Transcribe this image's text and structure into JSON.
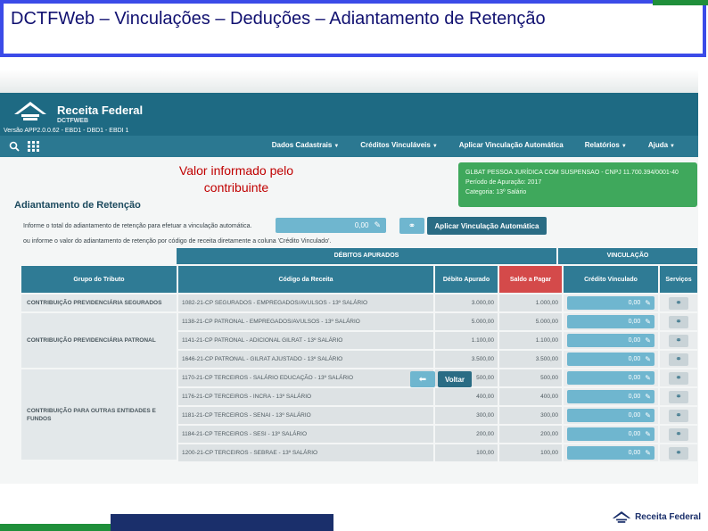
{
  "slide": {
    "title": "DCTFWeb – Vinculações – Deduções – Adiantamento de Retenção"
  },
  "app": {
    "brand": "Receita Federal",
    "product": "DCTFWEB",
    "version_line": "Versão APP2.0.0.62 - EBD1 - DBD1 - EBDI 1"
  },
  "nav": {
    "menu": [
      {
        "label": "Dados Cadastrais"
      },
      {
        "label": "Créditos Vinculáveis"
      },
      {
        "label": "Aplicar Vinculação Automática"
      },
      {
        "label": "Relatórios"
      },
      {
        "label": "Ajuda"
      }
    ]
  },
  "callout": "Valor informado pelo contribuinte",
  "info": {
    "line1": "GLBAT PESSOA JURÍDICA COM SUSPENSAO - CNPJ 11.700.394/0001-40",
    "line2": "Período de Apuração: 2017",
    "line3": "Categoria: 13º Salário"
  },
  "section_title": "Adiantamento de Retenção",
  "inform_text": "Informe o total do adiantamento de retenção para efetuar a vinculação automática.",
  "total_value": "0,00",
  "apply_button": "Aplicar Vinculação Automática",
  "or_text": "ou informe o valor do adiantamento de retenção por código de receita diretamente a coluna 'Crédito Vinculado'.",
  "table": {
    "group_header_debitos": "DÉBITOS APURADOS",
    "group_header_vinculacao": "VINCULAÇÃO",
    "columns": [
      "Grupo do Tributo",
      "Código da Receita",
      "Débito Apurado",
      "Saldo a Pagar",
      "Crédito Vinculado",
      "Serviços"
    ],
    "groups": [
      "CONTRIBUIÇÃO PREVIDENCIÁRIA SEGURADOS",
      "CONTRIBUIÇÃO PREVIDENCIÁRIA PATRONAL",
      "CONTRIBUIÇÃO PARA OUTRAS ENTIDADES E FUNDOS"
    ],
    "rows": [
      {
        "code": "1082-21-CP SEGURADOS - EMPREGADOS/AVULSOS - 13º SALÁRIO",
        "debito": "3.000,00",
        "saldo": "1.000,00",
        "vinculado": "0,00"
      },
      {
        "code": "1138-21-CP PATRONAL - EMPREGADOS/AVULSOS - 13º SALÁRIO",
        "debito": "5.000,00",
        "saldo": "5.000,00",
        "vinculado": "0,00"
      },
      {
        "code": "1141-21-CP PATRONAL - ADICIONAL GILRAT - 13º SALÁRIO",
        "debito": "1.100,00",
        "saldo": "1.100,00",
        "vinculado": "0,00"
      },
      {
        "code": "1646-21-CP PATRONAL - GILRAT AJUSTADO - 13º SALÁRIO",
        "debito": "3.500,00",
        "saldo": "3.500,00",
        "vinculado": "0,00"
      },
      {
        "code": "1170-21-CP TERCEIROS - SALÁRIO EDUCAÇÃO - 13º SALÁRIO",
        "debito": "500,00",
        "saldo": "500,00",
        "vinculado": "0,00"
      },
      {
        "code": "1176-21-CP TERCEIROS - INCRA - 13º SALÁRIO",
        "debito": "400,00",
        "saldo": "400,00",
        "vinculado": "0,00"
      },
      {
        "code": "1181-21-CP TERCEIROS - SENAI - 13º SALÁRIO",
        "debito": "300,00",
        "saldo": "300,00",
        "vinculado": "0,00"
      },
      {
        "code": "1184-21-CP TERCEIROS - SESI - 13º SALÁRIO",
        "debito": "200,00",
        "saldo": "200,00",
        "vinculado": "0,00"
      },
      {
        "code": "1200-21-CP TERCEIROS - SEBRAE - 13º SALÁRIO",
        "debito": "100,00",
        "saldo": "100,00",
        "vinculado": "0,00"
      }
    ]
  },
  "back_button": "Voltar",
  "footer_logo": "Receita Federal",
  "colors": {
    "header": "#1e6a83",
    "accent": "#2f7b95",
    "saldo": "#d44a4a",
    "info_box": "#3fa85c",
    "callout": "#c00000"
  }
}
